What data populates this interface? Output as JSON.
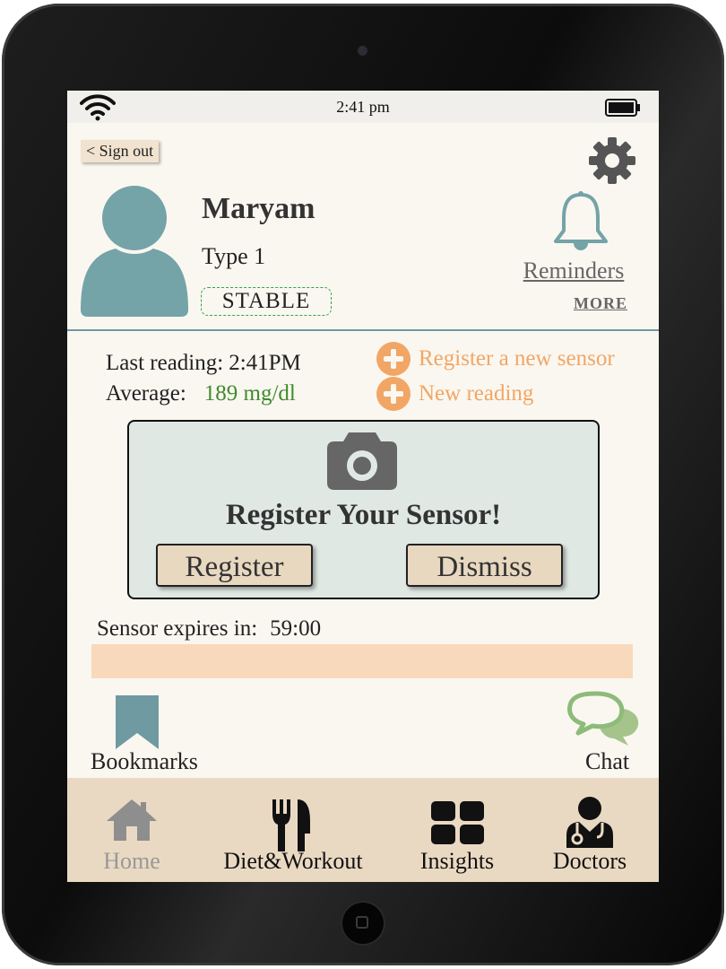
{
  "status_bar": {
    "time": "2:41 pm"
  },
  "header": {
    "sign_out": "< Sign out"
  },
  "profile": {
    "name": "Maryam",
    "type": "Type 1",
    "status": "STABLE"
  },
  "reminders": {
    "label": "Reminders",
    "more": "MORE"
  },
  "readings": {
    "last_reading_label": "Last reading:",
    "last_reading_value": "2:41PM",
    "average_label": "Average:",
    "average_value": "189 mg/dl"
  },
  "actions": [
    {
      "label": "Register a new sensor"
    },
    {
      "label": "New reading"
    }
  ],
  "sensor_card": {
    "title": "Register Your Sensor!",
    "register": "Register",
    "dismiss": "Dismiss"
  },
  "sensor_expiry": {
    "label": "Sensor expires in:",
    "value": "59:00",
    "progress": 1.0
  },
  "shortcuts": {
    "bookmarks": "Bookmarks",
    "chat": "Chat"
  },
  "tabs": [
    {
      "label": "Home",
      "icon": "home-icon",
      "active": true
    },
    {
      "label": "Diet&Workout",
      "icon": "fork-knife-icon"
    },
    {
      "label": "Insights",
      "icon": "grid-icon"
    },
    {
      "label": "Doctors",
      "icon": "doctor-icon"
    }
  ],
  "colors": {
    "accent_teal": "#74a3a8",
    "accent_orange": "#f2a665",
    "average_green": "#3f8b2e",
    "tab_bar": "#ead9c2",
    "progress": "#f9d9bb"
  }
}
